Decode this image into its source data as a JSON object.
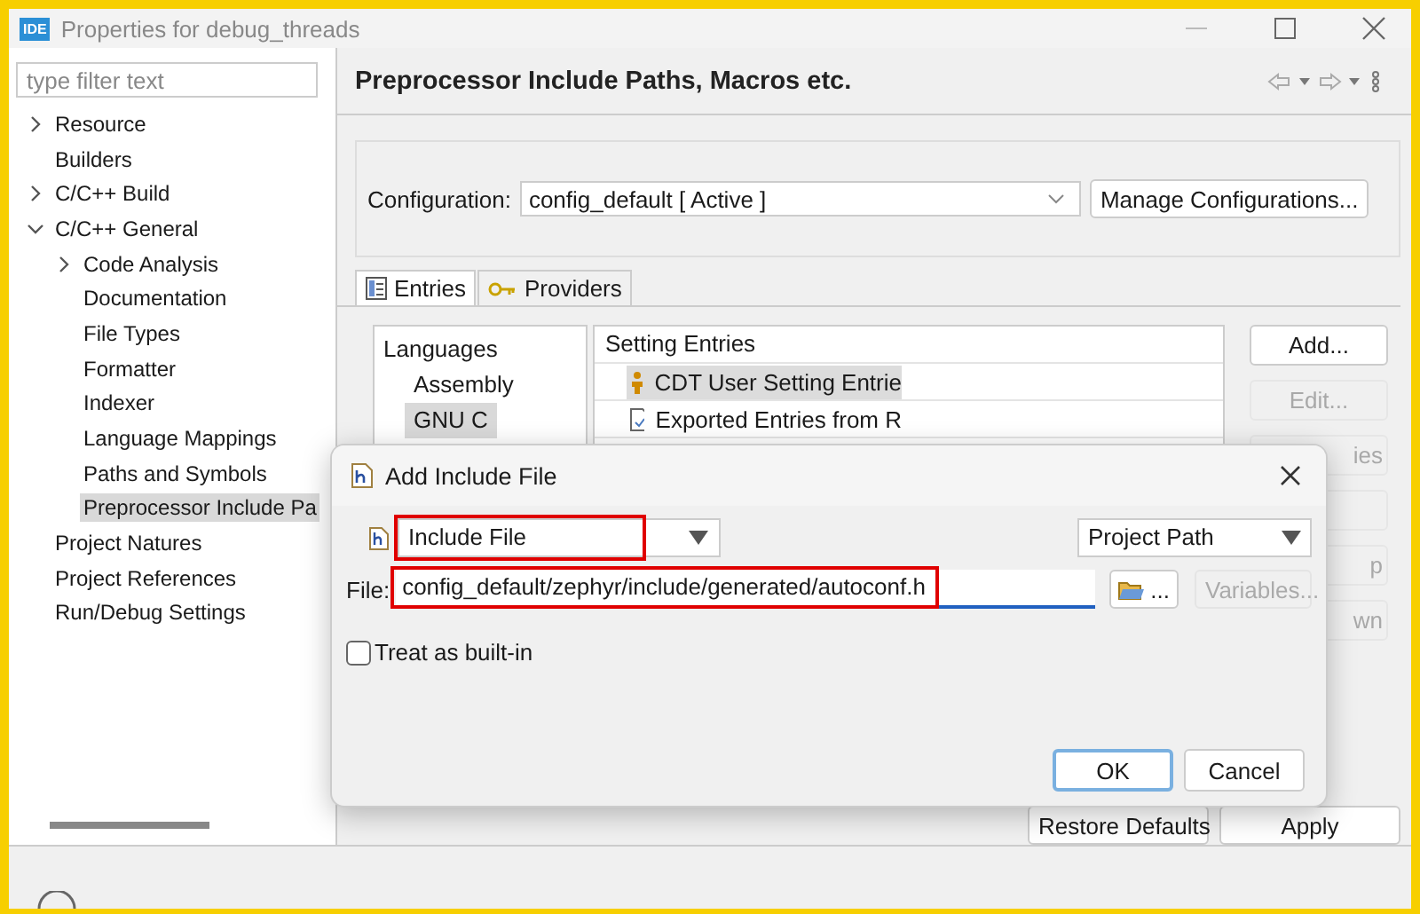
{
  "window": {
    "title": "Properties for debug_threads",
    "app_badge": "IDE"
  },
  "sidebar": {
    "filter": {
      "placeholder": "type filter text"
    },
    "items": [
      {
        "label": "Resource",
        "expanded": false,
        "selected": false
      },
      {
        "label": "Builders",
        "selected": false
      },
      {
        "label": "C/C++ Build",
        "expanded": false,
        "selected": false
      },
      {
        "label": "C/C++ General",
        "expanded": true,
        "selected": false,
        "children": [
          {
            "label": "Code Analysis",
            "expanded": false,
            "selected": false
          },
          {
            "label": "Documentation",
            "selected": false
          },
          {
            "label": "File Types",
            "selected": false
          },
          {
            "label": "Formatter",
            "selected": false
          },
          {
            "label": "Indexer",
            "selected": false
          },
          {
            "label": "Language Mappings",
            "selected": false
          },
          {
            "label": "Paths and Symbols",
            "selected": false
          },
          {
            "label": "Preprocessor Include Pa",
            "selected": true
          }
        ]
      },
      {
        "label": "Project Natures",
        "selected": false
      },
      {
        "label": "Project References",
        "selected": false
      },
      {
        "label": "Run/Debug Settings",
        "selected": false
      }
    ]
  },
  "page": {
    "title": "Preprocessor Include Paths, Macros etc.",
    "configuration": {
      "label": "Configuration:",
      "value": "config_default  [ Active ]",
      "manage_button": "Manage Configurations..."
    },
    "tabs": [
      {
        "label": "Entries",
        "selected": true
      },
      {
        "label": "Providers",
        "selected": false
      }
    ],
    "languages": {
      "heading": "Languages",
      "items": [
        {
          "label": "Assembly",
          "selected": false
        },
        {
          "label": "GNU C",
          "selected": true
        }
      ]
    },
    "entries": {
      "heading": "Setting Entries",
      "items": [
        {
          "label": "CDT User Setting Entrie",
          "selected": true
        },
        {
          "label": "Exported Entries from R",
          "selected": false
        }
      ]
    },
    "side_buttons": [
      {
        "label": "Add...",
        "disabled": false
      },
      {
        "label": "Edit...",
        "disabled": true
      },
      {
        "label": "ies",
        "disabled": true
      },
      {
        "disabled": true
      },
      {
        "label": "p",
        "disabled": true
      },
      {
        "label": "wn",
        "disabled": true
      }
    ],
    "footer_buttons": [
      "Restore Defaults",
      "Apply"
    ]
  },
  "dialog": {
    "title": "Add Include File",
    "type_select": {
      "value": "Include File",
      "highlighted": true
    },
    "path_select": {
      "value": "Project Path"
    },
    "file": {
      "label": "File:",
      "value": "config_default/zephyr/include/generated/autoconf.h",
      "highlighted": true
    },
    "browse_button": "...",
    "variables_button": {
      "label": "Variables...",
      "disabled": true
    },
    "builtin": {
      "label": "Treat as built-in",
      "checked": false
    },
    "buttons": [
      {
        "label": "OK",
        "default": true
      },
      {
        "label": "Cancel",
        "default": false
      }
    ]
  }
}
